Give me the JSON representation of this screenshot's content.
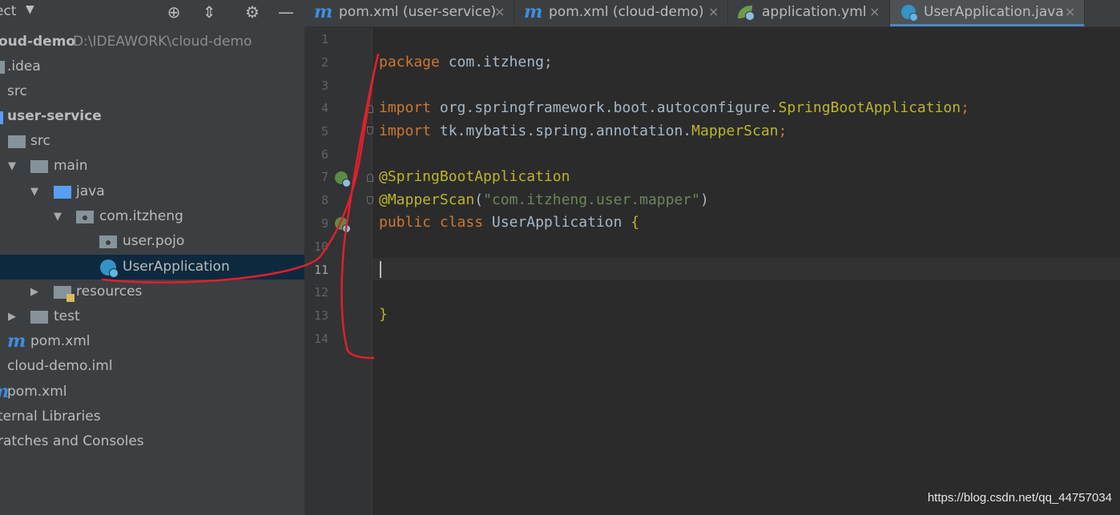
{
  "sidebar": {
    "title": "ect",
    "tree": [
      {
        "label": "oud-demo",
        "path": "D:\\IDEAWORK\\cloud-demo",
        "bold": true
      },
      {
        "label": ".idea"
      },
      {
        "label": "src"
      },
      {
        "label": "user-service",
        "bold": true
      },
      {
        "label": "src"
      },
      {
        "label": "main"
      },
      {
        "label": "java"
      },
      {
        "label": "com.itzheng"
      },
      {
        "label": "user.pojo"
      },
      {
        "label": "UserApplication",
        "selected": true
      },
      {
        "label": "resources"
      },
      {
        "label": "test"
      },
      {
        "label": "pom.xml"
      },
      {
        "label": "cloud-demo.iml"
      },
      {
        "label": "pom.xml"
      },
      {
        "label": "ternal Libraries"
      },
      {
        "label": "ratches and Consoles"
      }
    ]
  },
  "tabs": [
    {
      "label": "pom.xml (user-service)",
      "icon": "maven-icon"
    },
    {
      "label": "pom.xml (cloud-demo)",
      "icon": "maven-icon"
    },
    {
      "label": "application.yml",
      "icon": "spring-leaf-icon"
    },
    {
      "label": "UserApplication.java",
      "icon": "java-class-icon",
      "active": true
    }
  ],
  "tab_close_glyph": "×",
  "editor": {
    "line_numbers": [
      "1",
      "2",
      "3",
      "4",
      "5",
      "6",
      "7",
      "8",
      "9",
      "10",
      "11",
      "12",
      "13",
      "14"
    ],
    "current_line": "11",
    "lines": {
      "l2": {
        "kw": "package",
        "rest": " com.itzheng;"
      },
      "l4": {
        "kw": "import",
        "pkg": " org.springframework.boot.autoconfigure.",
        "cls": "SpringBootApplication",
        "end": ";"
      },
      "l5": {
        "kw": "import",
        "pkg": " tk.mybatis.spring.annotation.",
        "cls": "MapperScan",
        "end": ";"
      },
      "l7": {
        "ann": "@SpringBootApplication"
      },
      "l8": {
        "ann": "@MapperScan",
        "open": "(",
        "str": "\"com.itzheng.user.mapper\"",
        "close": ")"
      },
      "l9": {
        "kw1": "public",
        "kw2": "class",
        "name": " UserApplication ",
        "brace": "{"
      },
      "l13": {
        "brace": "}"
      }
    }
  },
  "watermark": "https://blog.csdn.net/qq_44757034",
  "colors": {
    "keyword": "#cc7832",
    "annotation": "#bbb529",
    "string": "#6a8759",
    "selection": "#0d293e",
    "annotation_stroke": "#e0202a"
  }
}
